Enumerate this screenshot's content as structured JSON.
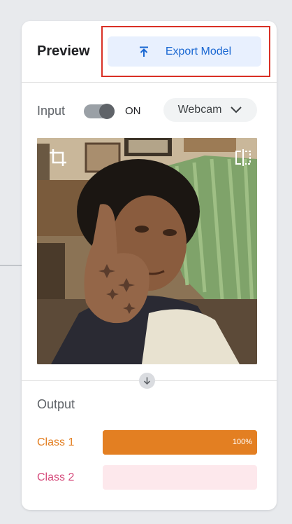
{
  "header": {
    "title": "Preview",
    "export_label": "Export Model"
  },
  "input": {
    "label": "Input",
    "toggle_state": "ON",
    "source_selected": "Webcam"
  },
  "output": {
    "label": "Output",
    "classes": [
      {
        "name": "Class 1",
        "confidence": 100,
        "confidence_text": "100%",
        "color": "#e37f22",
        "track_color": "#e37f22"
      },
      {
        "name": "Class 2",
        "confidence": 0,
        "confidence_text": "",
        "color": "#d64d7d",
        "track_color": "#fde8ec"
      }
    ]
  },
  "colors": {
    "accent_blue": "#1967d2",
    "export_bg": "#e8f0fe",
    "highlight_border": "#d93025"
  },
  "icons": {
    "export": "upload-arrow-icon",
    "dropdown": "chevron-down-icon",
    "crop": "crop-icon",
    "flip": "flip-horizontal-icon",
    "divider_arrow": "arrow-down-icon"
  }
}
